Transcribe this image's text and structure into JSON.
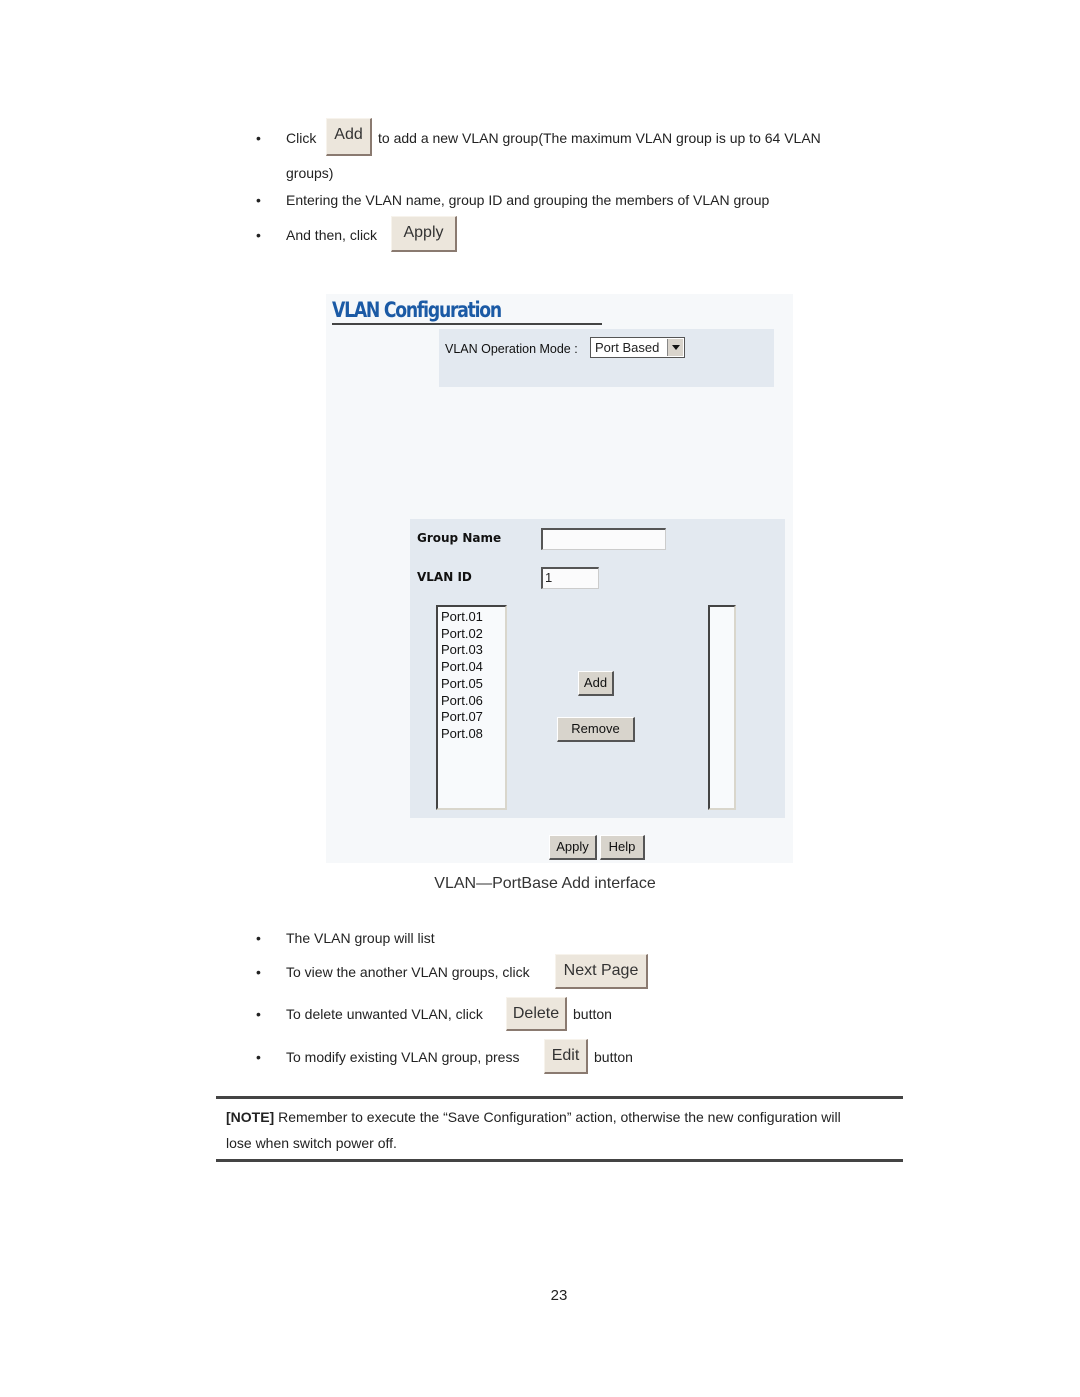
{
  "intro_bullets": {
    "b1_prefix": "Click",
    "b1_button": "Add",
    "b1_suffix": "to add a new VLAN group(The maximum VLAN group is up to 64 VLAN",
    "b1_wrap": "groups)",
    "b2": "Entering the VLAN name, group ID and grouping the members of VLAN group",
    "b3_prefix": "And then, click",
    "b3_button": "Apply"
  },
  "screenshot": {
    "title": "VLAN Configuration",
    "operation_mode_label": "VLAN Operation Mode :",
    "operation_mode_value": "Port Based",
    "group_name_label": "Group Name",
    "group_name_value": "",
    "vlan_id_label": "VLAN ID",
    "vlan_id_value": "1",
    "available_ports": [
      "Port.01",
      "Port.02",
      "Port.03",
      "Port.04",
      "Port.05",
      "Port.06",
      "Port.07",
      "Port.08"
    ],
    "member_ports": [],
    "add_button": "Add",
    "remove_button": "Remove",
    "apply_button": "Apply",
    "help_button": "Help"
  },
  "caption": "VLAN—PortBase Add interface",
  "list_bullets": {
    "b1": "The VLAN group will list",
    "b2_prefix": "To view the another VLAN groups, click",
    "b2_button": "Next Page",
    "b3_prefix": "To delete unwanted VLAN, click",
    "b3_button": "Delete",
    "b3_suffix": "button",
    "b4_prefix": "To modify existing VLAN group, press",
    "b4_button": "Edit",
    "b4_suffix": "button"
  },
  "note": {
    "tag": "[NOTE]",
    "line1": " Remember to execute the “Save Configuration” action, otherwise the new configuration will",
    "line2": "lose when switch power off."
  },
  "page_number": "23",
  "bullet_glyph": "•"
}
